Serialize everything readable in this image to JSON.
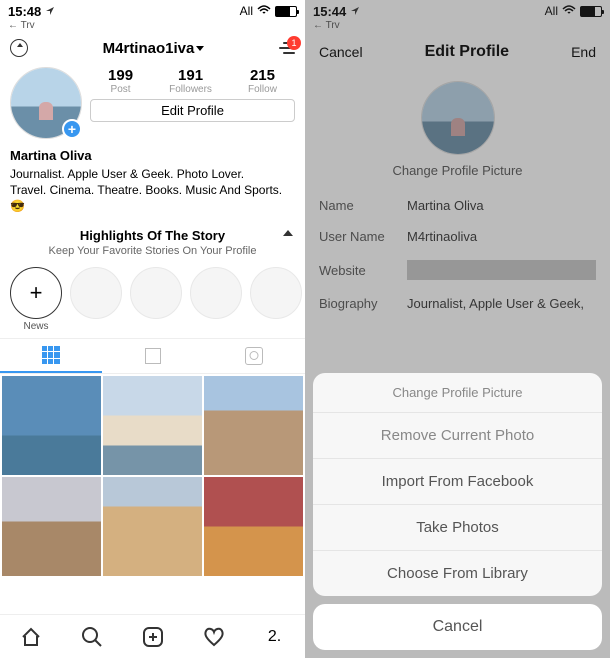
{
  "left": {
    "status": {
      "time": "15:48",
      "try": "← Trv",
      "all": "All"
    },
    "header": {
      "username": "M4rtinao1iva"
    },
    "badge": "1",
    "stats": {
      "posts": {
        "num": "199",
        "lbl": "Post"
      },
      "followers": {
        "num": "191",
        "lbl": "Followers"
      },
      "follow": {
        "num": "215",
        "lbl": "Follow"
      }
    },
    "editProfile": "Edit Profile",
    "bio": {
      "name": "Martina Oliva",
      "line1": "Journalist. Apple User & Geek. Photo Lover.",
      "line2": "Travel. Cinema. Theatre. Books. Music And Sports."
    },
    "highlights": {
      "title": "Highlights Of The Story",
      "sub": "Keep Your Favorite Stories On Your Profile",
      "new": "News"
    },
    "counter": "2."
  },
  "right": {
    "status": {
      "time": "15:44",
      "try": "← Trv",
      "all": "All"
    },
    "header": {
      "cancel": "Cancel",
      "title": "Edit Profile",
      "end": "End"
    },
    "changeLink": "Change Profile Picture",
    "form": {
      "nameLbl": "Name",
      "nameVal": "Martina Oliva",
      "userLbl": "User Name",
      "userVal": "M4rtinaoliva",
      "webLbl": "Website",
      "bioLbl": "Biography",
      "bioVal": "Journalist, Apple User & Geek,"
    },
    "sheet": {
      "title": "Change Profile Picture",
      "remove": "Remove Current Photo",
      "facebook": "Import From Facebook",
      "take": "Take Photos",
      "library": "Choose From Library",
      "cancel": "Cancel"
    }
  }
}
